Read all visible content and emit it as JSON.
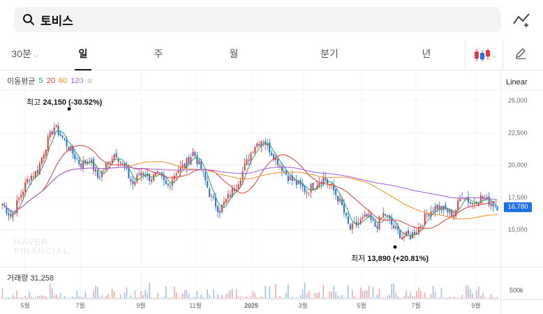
{
  "search": {
    "query": "토비스",
    "icon": "search-icon"
  },
  "toolbar": {
    "compare_icon": "chart-compare-icon",
    "candle_icon": "candlestick-icon",
    "draw_icon": "pencil-icon"
  },
  "tabs": [
    {
      "label": "30분"
    },
    {
      "label": "일"
    },
    {
      "label": "주"
    },
    {
      "label": "월"
    },
    {
      "label": "분기"
    },
    {
      "label": "년"
    }
  ],
  "active_tab": "일",
  "indicators": {
    "title": "이동평균",
    "ma": [
      {
        "label": "5",
        "color": "#2aa05b"
      },
      {
        "label": "20",
        "color": "#e53935"
      },
      {
        "label": "60",
        "color": "#f28c1c"
      },
      {
        "label": "120",
        "color": "#a05ad8"
      }
    ]
  },
  "scale": "Linear",
  "annotations": {
    "high_label": "최고",
    "high_value": "24,150 (-30.52%)",
    "low_label": "최저",
    "low_value": "13,890 (+20.81%)"
  },
  "current_price": "16,780",
  "volume": {
    "label": "거래량",
    "value": "31,258",
    "axis_label": "500k"
  },
  "watermark": [
    "NAVER",
    "FINANCIAL"
  ],
  "colors": {
    "up": "#e53935",
    "down": "#1f6fe5",
    "price_tag": "#1f6fe5"
  },
  "chart_data": {
    "type": "candlestick",
    "y_ticks": [
      "25,000",
      "22,500",
      "20,000",
      "17,500",
      "15,000"
    ],
    "x_ticks": [
      "5월",
      "7월",
      "9월",
      "11월",
      "2025",
      "3월",
      "5월",
      "7월",
      "9월"
    ],
    "ylim": [
      13000,
      26000
    ],
    "close_series": [
      17000,
      16000,
      17500,
      19000,
      19500,
      21500,
      23000,
      22000,
      21000,
      20000,
      20500,
      19000,
      20000,
      21000,
      19800,
      18500,
      19500,
      19000,
      19200,
      18300,
      19500,
      20000,
      21000,
      19500,
      17500,
      16500,
      17500,
      18500,
      20000,
      21500,
      22000,
      21000,
      20000,
      19000,
      18500,
      18000,
      18500,
      19000,
      18200,
      17000,
      15000,
      15500,
      16000,
      15200,
      16300,
      15200,
      14500,
      14500,
      15200,
      16300,
      16800,
      16500,
      16200,
      17800,
      17000,
      17500,
      17200,
      16800
    ],
    "ma5_note": "moving averages shown as smoothed lines"
  }
}
